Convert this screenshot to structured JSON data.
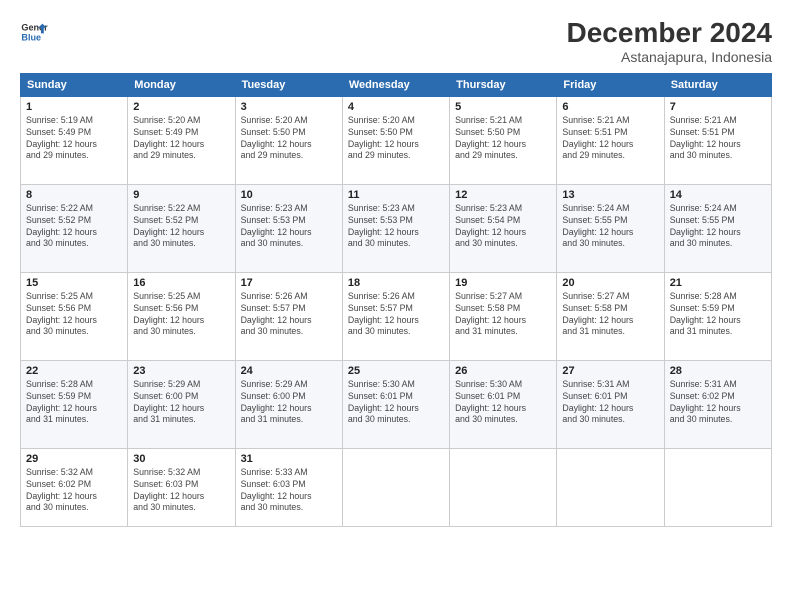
{
  "header": {
    "logo_line1": "General",
    "logo_line2": "Blue",
    "title": "December 2024",
    "subtitle": "Astanajapura, Indonesia"
  },
  "columns": [
    "Sunday",
    "Monday",
    "Tuesday",
    "Wednesday",
    "Thursday",
    "Friday",
    "Saturday"
  ],
  "weeks": [
    [
      {
        "day": "1",
        "info": "Sunrise: 5:19 AM\nSunset: 5:49 PM\nDaylight: 12 hours\nand 29 minutes."
      },
      {
        "day": "2",
        "info": "Sunrise: 5:20 AM\nSunset: 5:49 PM\nDaylight: 12 hours\nand 29 minutes."
      },
      {
        "day": "3",
        "info": "Sunrise: 5:20 AM\nSunset: 5:50 PM\nDaylight: 12 hours\nand 29 minutes."
      },
      {
        "day": "4",
        "info": "Sunrise: 5:20 AM\nSunset: 5:50 PM\nDaylight: 12 hours\nand 29 minutes."
      },
      {
        "day": "5",
        "info": "Sunrise: 5:21 AM\nSunset: 5:50 PM\nDaylight: 12 hours\nand 29 minutes."
      },
      {
        "day": "6",
        "info": "Sunrise: 5:21 AM\nSunset: 5:51 PM\nDaylight: 12 hours\nand 29 minutes."
      },
      {
        "day": "7",
        "info": "Sunrise: 5:21 AM\nSunset: 5:51 PM\nDaylight: 12 hours\nand 30 minutes."
      }
    ],
    [
      {
        "day": "8",
        "info": "Sunrise: 5:22 AM\nSunset: 5:52 PM\nDaylight: 12 hours\nand 30 minutes."
      },
      {
        "day": "9",
        "info": "Sunrise: 5:22 AM\nSunset: 5:52 PM\nDaylight: 12 hours\nand 30 minutes."
      },
      {
        "day": "10",
        "info": "Sunrise: 5:23 AM\nSunset: 5:53 PM\nDaylight: 12 hours\nand 30 minutes."
      },
      {
        "day": "11",
        "info": "Sunrise: 5:23 AM\nSunset: 5:53 PM\nDaylight: 12 hours\nand 30 minutes."
      },
      {
        "day": "12",
        "info": "Sunrise: 5:23 AM\nSunset: 5:54 PM\nDaylight: 12 hours\nand 30 minutes."
      },
      {
        "day": "13",
        "info": "Sunrise: 5:24 AM\nSunset: 5:55 PM\nDaylight: 12 hours\nand 30 minutes."
      },
      {
        "day": "14",
        "info": "Sunrise: 5:24 AM\nSunset: 5:55 PM\nDaylight: 12 hours\nand 30 minutes."
      }
    ],
    [
      {
        "day": "15",
        "info": "Sunrise: 5:25 AM\nSunset: 5:56 PM\nDaylight: 12 hours\nand 30 minutes."
      },
      {
        "day": "16",
        "info": "Sunrise: 5:25 AM\nSunset: 5:56 PM\nDaylight: 12 hours\nand 30 minutes."
      },
      {
        "day": "17",
        "info": "Sunrise: 5:26 AM\nSunset: 5:57 PM\nDaylight: 12 hours\nand 30 minutes."
      },
      {
        "day": "18",
        "info": "Sunrise: 5:26 AM\nSunset: 5:57 PM\nDaylight: 12 hours\nand 30 minutes."
      },
      {
        "day": "19",
        "info": "Sunrise: 5:27 AM\nSunset: 5:58 PM\nDaylight: 12 hours\nand 31 minutes."
      },
      {
        "day": "20",
        "info": "Sunrise: 5:27 AM\nSunset: 5:58 PM\nDaylight: 12 hours\nand 31 minutes."
      },
      {
        "day": "21",
        "info": "Sunrise: 5:28 AM\nSunset: 5:59 PM\nDaylight: 12 hours\nand 31 minutes."
      }
    ],
    [
      {
        "day": "22",
        "info": "Sunrise: 5:28 AM\nSunset: 5:59 PM\nDaylight: 12 hours\nand 31 minutes."
      },
      {
        "day": "23",
        "info": "Sunrise: 5:29 AM\nSunset: 6:00 PM\nDaylight: 12 hours\nand 31 minutes."
      },
      {
        "day": "24",
        "info": "Sunrise: 5:29 AM\nSunset: 6:00 PM\nDaylight: 12 hours\nand 31 minutes."
      },
      {
        "day": "25",
        "info": "Sunrise: 5:30 AM\nSunset: 6:01 PM\nDaylight: 12 hours\nand 30 minutes."
      },
      {
        "day": "26",
        "info": "Sunrise: 5:30 AM\nSunset: 6:01 PM\nDaylight: 12 hours\nand 30 minutes."
      },
      {
        "day": "27",
        "info": "Sunrise: 5:31 AM\nSunset: 6:01 PM\nDaylight: 12 hours\nand 30 minutes."
      },
      {
        "day": "28",
        "info": "Sunrise: 5:31 AM\nSunset: 6:02 PM\nDaylight: 12 hours\nand 30 minutes."
      }
    ],
    [
      {
        "day": "29",
        "info": "Sunrise: 5:32 AM\nSunset: 6:02 PM\nDaylight: 12 hours\nand 30 minutes."
      },
      {
        "day": "30",
        "info": "Sunrise: 5:32 AM\nSunset: 6:03 PM\nDaylight: 12 hours\nand 30 minutes."
      },
      {
        "day": "31",
        "info": "Sunrise: 5:33 AM\nSunset: 6:03 PM\nDaylight: 12 hours\nand 30 minutes."
      },
      null,
      null,
      null,
      null
    ]
  ]
}
